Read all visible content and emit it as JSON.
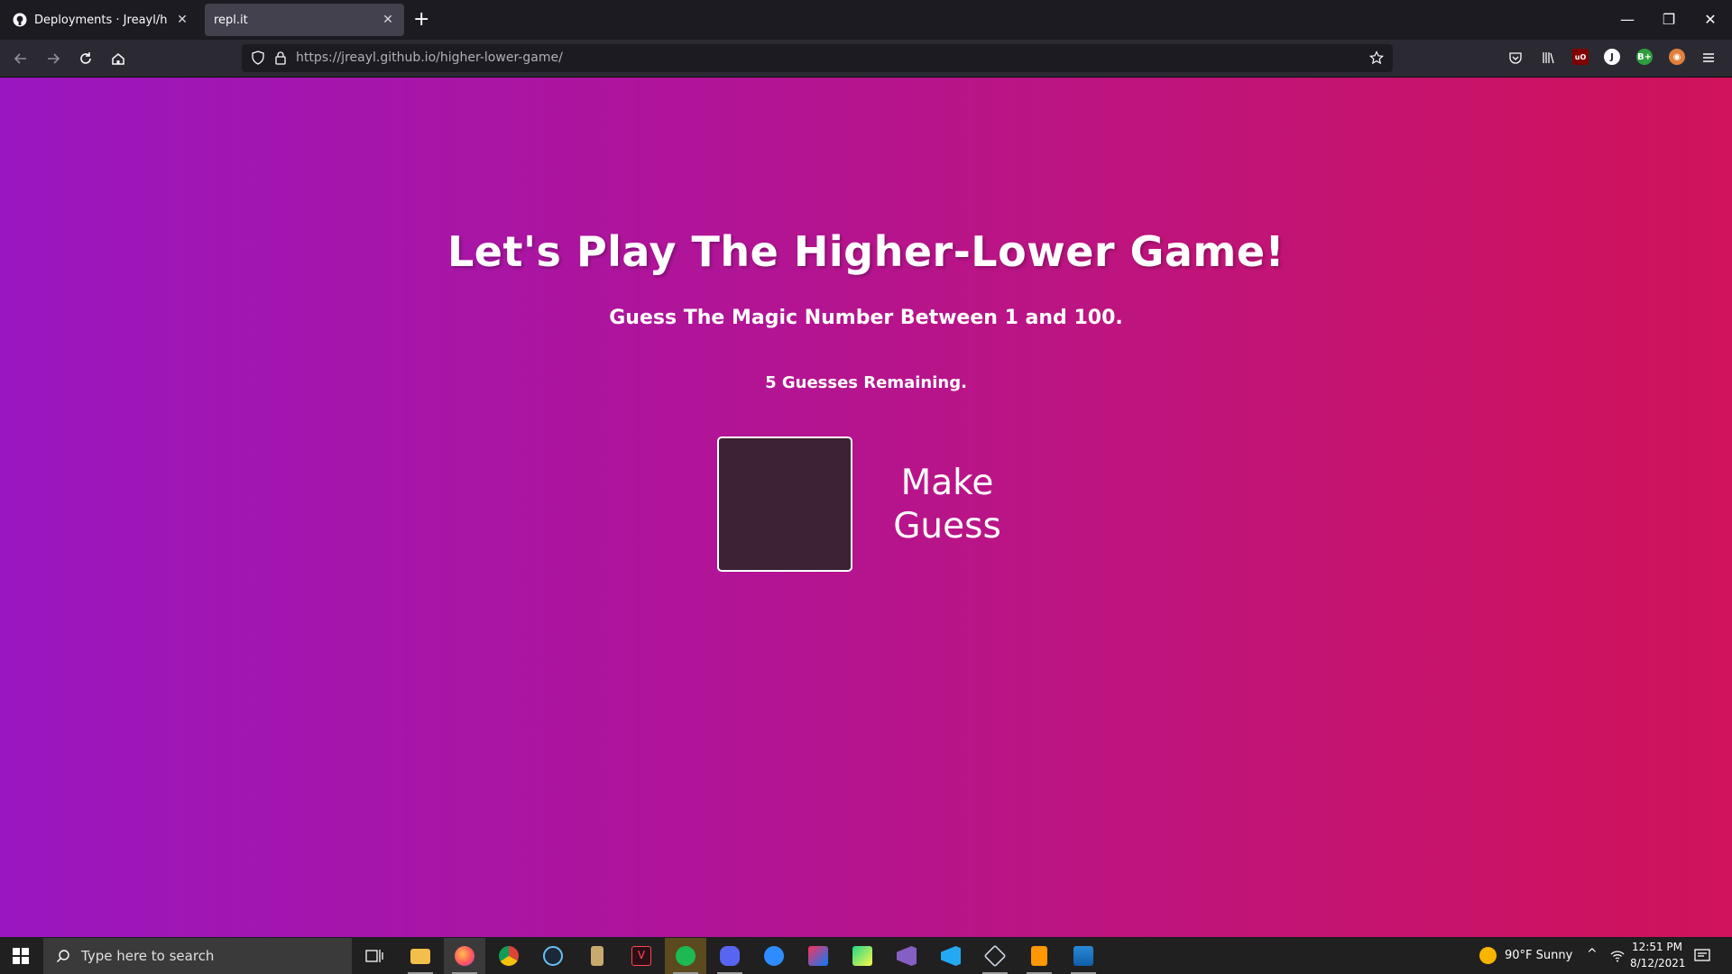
{
  "browser": {
    "tabs": [
      {
        "title": "Deployments · Jreayl/higher-lower-game",
        "active": false
      },
      {
        "title": "repl.it",
        "active": true
      }
    ],
    "new_tab_label": "+",
    "url_host": "https://jreayl.github.io",
    "url_path": "/higher-lower-game/"
  },
  "page": {
    "heading": "Let's Play The Higher-Lower Game!",
    "subheading": "Guess The Magic Number Between 1 and 100.",
    "guesses_remaining": "5 Guesses Remaining.",
    "input_value": "",
    "button_label": "Make Guess",
    "colors": {
      "gradient_start": "#9a16c0",
      "gradient_end": "#d0135a",
      "input_bg": "#3c2233"
    }
  },
  "taskbar": {
    "search_placeholder": "Type here to search",
    "weather": "90°F  Sunny",
    "time": "12:51 PM",
    "date": "8/12/2021",
    "pinned": [
      "task-view",
      "file-explorer",
      "firefox",
      "chrome",
      "steam",
      "league",
      "valorant",
      "spotify",
      "discord",
      "zoom",
      "intellij",
      "pycharm",
      "visual-studio",
      "vscode",
      "virtualbox",
      "sublime",
      "photos"
    ]
  }
}
